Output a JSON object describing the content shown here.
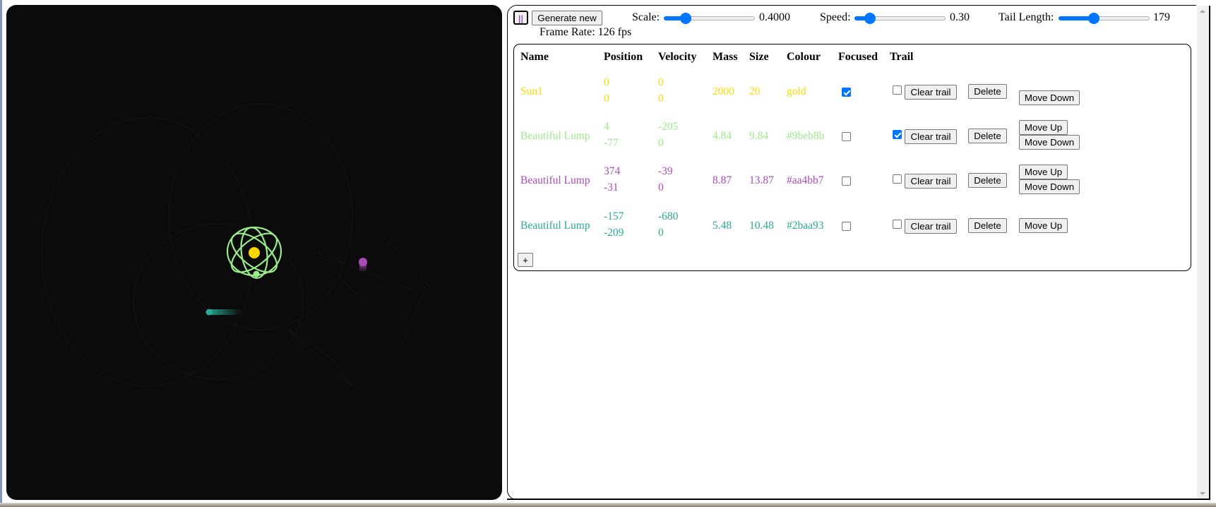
{
  "controls": {
    "pause_label": "||",
    "generate_label": "Generate new",
    "scale": {
      "label": "Scale:",
      "value_text": "0.4000",
      "fraction": 0.2
    },
    "speed": {
      "label": "Speed:",
      "value_text": "0.30",
      "fraction": 0.12
    },
    "tail_length": {
      "label": "Tail Length:",
      "value_text": "179",
      "fraction": 0.37
    },
    "frame_rate": "Frame Rate: 126 fps"
  },
  "table": {
    "headers": [
      "Name",
      "Position",
      "Velocity",
      "Mass",
      "Size",
      "Colour",
      "Focused",
      "Trail"
    ],
    "rows": [
      {
        "name": "Sun1",
        "pos_x": "0",
        "pos_y": "0",
        "vel_x": "0",
        "vel_y": "0",
        "mass": "2000",
        "size": "20",
        "colour": "gold",
        "color_hex": "#ffd700",
        "focused": true,
        "trail": false,
        "move_up": false,
        "move_down": true
      },
      {
        "name": "Beautiful Lump",
        "pos_x": "4",
        "pos_y": "-77",
        "vel_x": "-205",
        "vel_y": "0",
        "mass": "4.84",
        "size": "9.84",
        "colour": "#9beb8b",
        "color_hex": "#9beb8b",
        "focused": false,
        "trail": true,
        "move_up": true,
        "move_down": true
      },
      {
        "name": "Beautiful Lump",
        "pos_x": "374",
        "pos_y": "-31",
        "vel_x": "-39",
        "vel_y": "0",
        "mass": "8.87",
        "size": "13.87",
        "colour": "#aa4bb7",
        "color_hex": "#aa4bb7",
        "focused": false,
        "trail": false,
        "move_up": true,
        "move_down": true
      },
      {
        "name": "Beautiful Lump",
        "pos_x": "-157",
        "pos_y": "-209",
        "vel_x": "-680",
        "vel_y": "0",
        "mass": "5.48",
        "size": "10.48",
        "colour": "#2baa93",
        "color_hex": "#2baa93",
        "focused": false,
        "trail": false,
        "move_up": true,
        "move_down": false
      }
    ],
    "clear_trail_label": "Clear trail",
    "delete_label": "Delete",
    "move_up_label": "Move Up",
    "move_down_label": "Move Down",
    "add_label": "+"
  },
  "canvas": {
    "background": "#0b0b0b"
  }
}
